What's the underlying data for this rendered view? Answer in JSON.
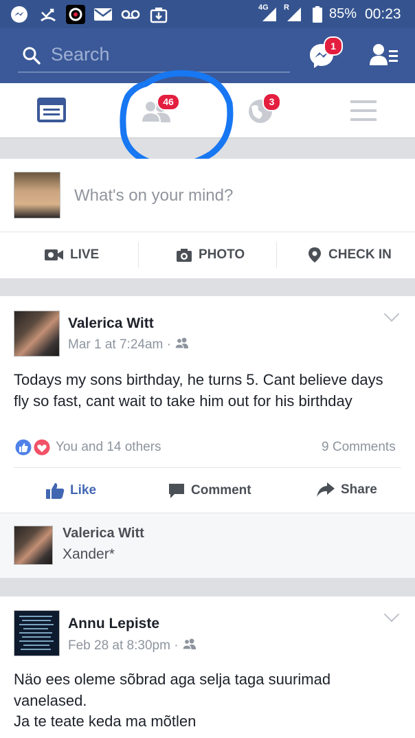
{
  "status_bar": {
    "battery": "85%",
    "time": "00:23",
    "network": "4G",
    "roaming": "R"
  },
  "header": {
    "search_placeholder": "Search",
    "messenger_badge": "1"
  },
  "nav": {
    "friend_requests_badge": "46",
    "notifications_badge": "3"
  },
  "composer": {
    "placeholder": "What's on your mind?",
    "live_label": "LIVE",
    "photo_label": "PHOTO",
    "checkin_label": "CHECK IN"
  },
  "post1": {
    "author": "Valerica Witt",
    "timestamp": "Mar 1 at 7:24am",
    "text": "Todays my sons birthday,  he turns 5. Cant believe days fly so fast,  cant wait to take him out for his birthday",
    "reactions": "You and 14 others",
    "comments_count": "9 Comments",
    "like_label": "Like",
    "comment_label": "Comment",
    "share_label": "Share",
    "top_comment": {
      "author": "Valerica Witt",
      "text": "Xander*"
    }
  },
  "post2": {
    "author": "Annu Lepiste",
    "timestamp": "Feb 28 at 8:30pm",
    "text_line1": "Näo ees oleme sõbrad aga selja taga suurimad vanelased.",
    "text_line2": "Ja te teate keda ma mõtlen"
  },
  "colors": {
    "brand": "#3b5998",
    "badge": "#e41e3f",
    "link": "#4267b2",
    "annotation": "#1877f2"
  }
}
